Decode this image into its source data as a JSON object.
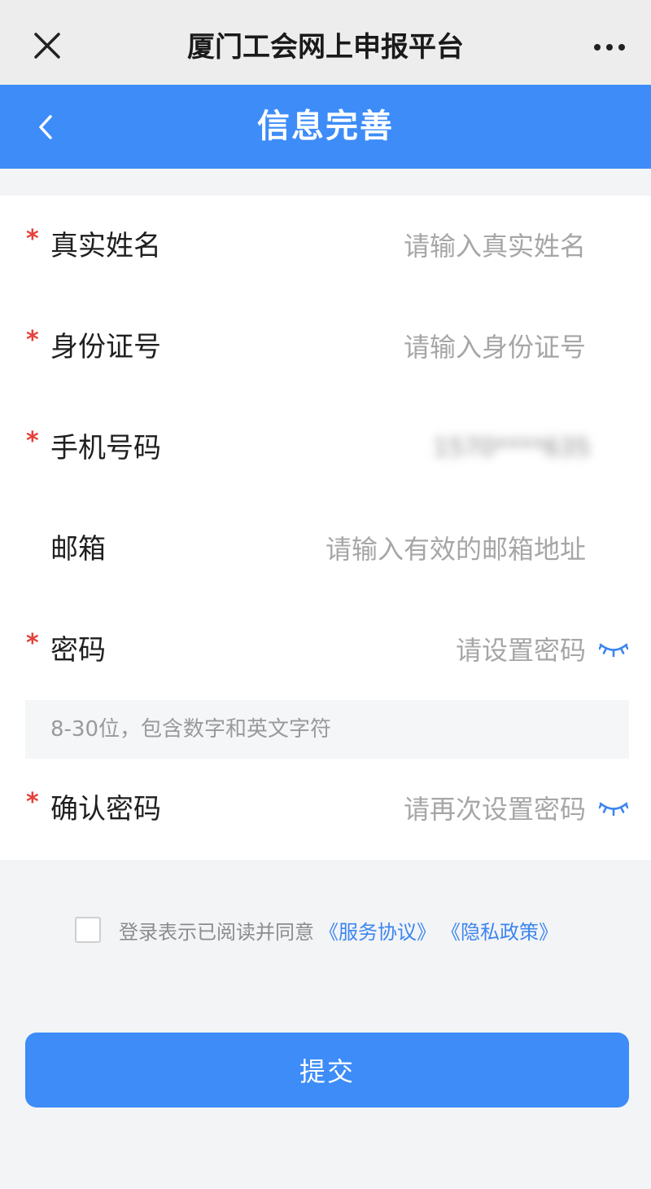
{
  "topbar": {
    "title": "厦门工会网上申报平台",
    "close_icon": "close-icon",
    "more_icon": "more-horizontal-icon"
  },
  "header": {
    "title": "信息完善",
    "back_icon": "chevron-left-icon"
  },
  "form": {
    "real_name": {
      "label": "真实姓名",
      "required_mark": "*",
      "placeholder": "请输入真实姓名"
    },
    "id_number": {
      "label": "身份证号",
      "required_mark": "*",
      "placeholder": "请输入身份证号"
    },
    "phone": {
      "label": "手机号码",
      "required_mark": "*",
      "value": "1570****635"
    },
    "email": {
      "label": "邮箱",
      "placeholder": "请输入有效的邮箱地址"
    },
    "password": {
      "label": "密码",
      "required_mark": "*",
      "placeholder": "请设置密码",
      "toggle_icon": "eye-closed-icon"
    },
    "password_hint": "8-30位，包含数字和英文字符",
    "confirm_password": {
      "label": "确认密码",
      "required_mark": "*",
      "placeholder": "请再次设置密码",
      "toggle_icon": "eye-closed-icon"
    }
  },
  "agreement": {
    "text": "登录表示已阅读并同意",
    "service_link": "《服务协议》",
    "privacy_link": "《隐私政策》"
  },
  "submit_label": "提交",
  "colors": {
    "primary": "#3d8cf8",
    "required": "#e5403b",
    "link": "#3c86f0",
    "background": "#f3f4f6"
  }
}
